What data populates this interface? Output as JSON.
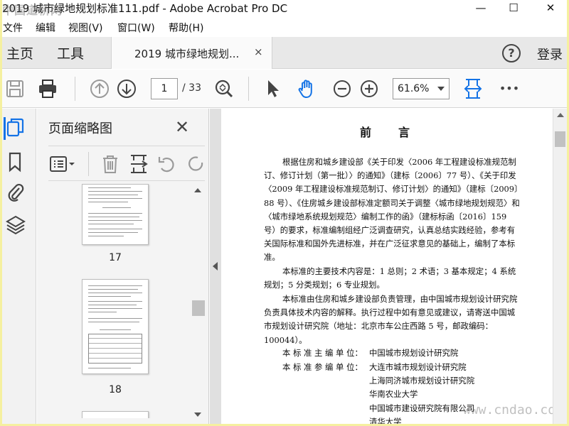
{
  "window": {
    "title": "2019 城市绿地规划标准111.pdf - Adobe Acrobat Pro DC",
    "watermark": "中国道桥网",
    "minimize": "—",
    "maximize": "☐",
    "close": "✕"
  },
  "menu": [
    "文件",
    "编辑",
    "视图(V)",
    "窗口(W)",
    "帮助(H)"
  ],
  "tabs": {
    "home": "主页",
    "tools": "工具",
    "document": "2019 城市绿地规划...",
    "close": "×"
  },
  "header_right": {
    "help": "?",
    "login": "登录"
  },
  "toolbar": {
    "page_current": "1",
    "page_total": "/ 33",
    "zoom": "61.6%",
    "more": "•••"
  },
  "panel": {
    "title": "页面缩略图",
    "close": "✕",
    "thumbnails": [
      {
        "label": "17"
      },
      {
        "label": "18"
      }
    ]
  },
  "document": {
    "heading": "前言",
    "paragraphs": [
      "根据住房和城乡建设部《关于印发〈2006 年工程建设标准规范制订、修订计划（第一批）〉的通知》（建标〔2006〕77 号）、《关于印发〈2009 年工程建设标准规范制订、修订计划〉的通知》（建标〔2009〕88 号）、《住房城乡建设部标准定额司关于调整〈城市绿地规划规范〉和〈城市绿地系统规划规范〉编制工作的函》（建标标函〔2016〕159 号）的要求，标准编制组经广泛调查研究，认真总结实践经验，参考有关国际标准和国外先进标准，并在广泛征求意见的基础上，编制了本标准。",
      "本标准的主要技术内容是：1 总则；2 术语；3 基本规定；4 系统规划；5 分类规划；6 专业规划。",
      "本标准由住房和城乡建设部负责管理，由中国城市规划设计研究院负责具体技术内容的解释。执行过程中如有意见或建议，请寄送中国城市规划设计研究院（地址：北京市车公庄西路 5 号，邮政编码：100044）。"
    ],
    "chief_unit_label": "本 标 准 主 编 单 位：",
    "chief_unit": "中国城市规划设计研究院",
    "co_unit_label": "本 标 准 参 编 单 位：",
    "co_units": [
      "大连市城市规划设计研究院",
      "上海同济城市规划设计研究院",
      "华南农业大学",
      "中国城市建设研究院有限公司",
      "清华大学"
    ],
    "site_watermark": "www.cndao.com"
  }
}
